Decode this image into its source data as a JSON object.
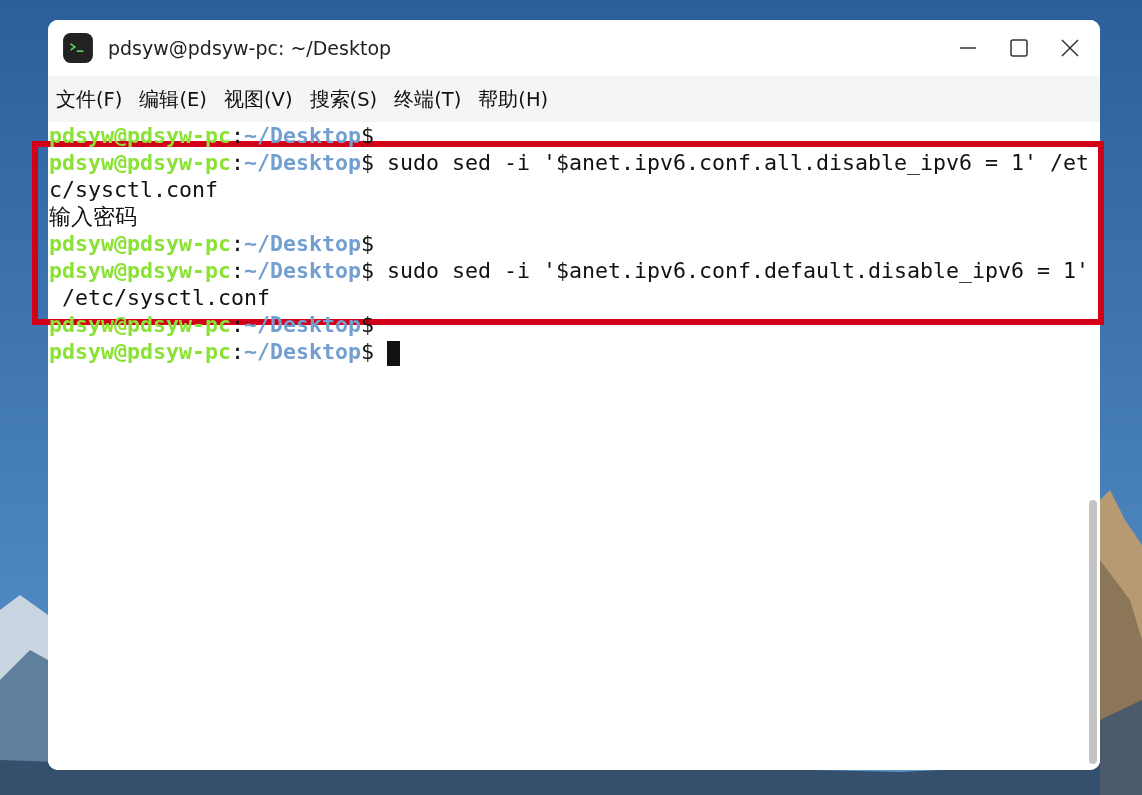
{
  "window": {
    "title": "pdsyw@pdsyw-pc: ~/Desktop"
  },
  "menu": [
    {
      "label": "文件(F)"
    },
    {
      "label": "编辑(E)"
    },
    {
      "label": "视图(V)"
    },
    {
      "label": "搜索(S)"
    },
    {
      "label": "终端(T)"
    },
    {
      "label": "帮助(H)"
    }
  ],
  "terminal": {
    "lines": [
      {
        "kind": "prompt",
        "user": "pdsyw@pdsyw-pc",
        "sep": ":",
        "path": "~/Desktop",
        "sign": "$"
      },
      {
        "kind": "prompt",
        "user": "pdsyw@pdsyw-pc",
        "sep": ":",
        "path": "~/Desktop",
        "sign": "$",
        "command": " sudo sed -i '$anet.ipv6.conf.all.disable_ipv6 = 1' /et"
      },
      {
        "kind": "output",
        "text": "c/sysctl.conf"
      },
      {
        "kind": "output",
        "text": "输入密码"
      },
      {
        "kind": "prompt",
        "user": "pdsyw@pdsyw-pc",
        "sep": ":",
        "path": "~/Desktop",
        "sign": "$"
      },
      {
        "kind": "prompt",
        "user": "pdsyw@pdsyw-pc",
        "sep": ":",
        "path": "~/Desktop",
        "sign": "$",
        "command": " sudo sed -i '$anet.ipv6.conf.default.disable_ipv6 = 1'"
      },
      {
        "kind": "output",
        "text": " /etc/sysctl.conf"
      },
      {
        "kind": "prompt",
        "user": "pdsyw@pdsyw-pc",
        "sep": ":",
        "path": "~/Desktop",
        "sign": "$"
      },
      {
        "kind": "prompt",
        "user": "pdsyw@pdsyw-pc",
        "sep": ":",
        "path": "~/Desktop",
        "sign": "$",
        "cursor": true
      }
    ]
  }
}
